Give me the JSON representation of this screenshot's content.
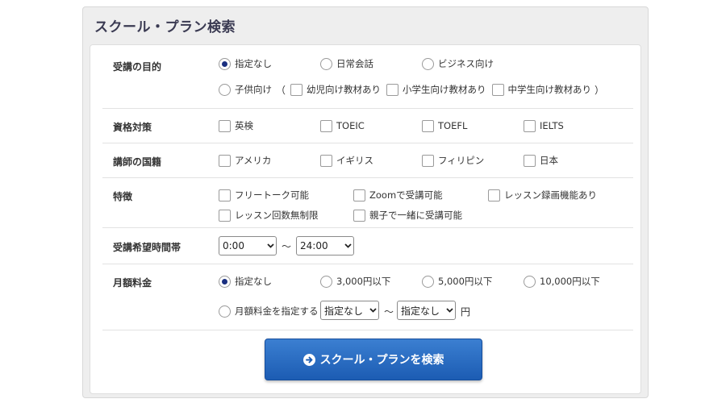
{
  "panel": {
    "title": "スクール・プラン検索"
  },
  "purpose": {
    "label": "受講の目的",
    "options": [
      "指定なし",
      "日常会話",
      "ビジネス向け",
      "子供向け"
    ],
    "selected": "指定なし",
    "paren_open": "（",
    "paren_close": "）",
    "sub_options": [
      "幼児向け教材あり",
      "小学生向け教材あり",
      "中学生向け教材あり"
    ]
  },
  "qualification": {
    "label": "資格対策",
    "options": [
      "英検",
      "TOEIC",
      "TOEFL",
      "IELTS"
    ]
  },
  "nationality": {
    "label": "講師の国籍",
    "options": [
      "アメリカ",
      "イギリス",
      "フィリピン",
      "日本"
    ]
  },
  "features": {
    "label": "特徴",
    "options": [
      "フリートーク可能",
      "Zoomで受講可能",
      "レッスン録画機能あり",
      "レッスン回数無制限",
      "親子で一緒に受講可能"
    ]
  },
  "time": {
    "label": "受講希望時間帯",
    "from": "0:00",
    "separator": "～",
    "to": "24:00"
  },
  "fee": {
    "label": "月額料金",
    "options": [
      "指定なし",
      "3,000円以下",
      "5,000円以下",
      "10,000円以下"
    ],
    "selected": "指定なし",
    "custom_label": "月額料金を指定する",
    "min": "指定なし",
    "separator": "～",
    "max": "指定なし",
    "unit": "円"
  },
  "search_button": {
    "label": "スクール・プランを検索"
  },
  "colors": {
    "accent": "#1c5cb3",
    "radio_dot": "#1a2f80"
  }
}
